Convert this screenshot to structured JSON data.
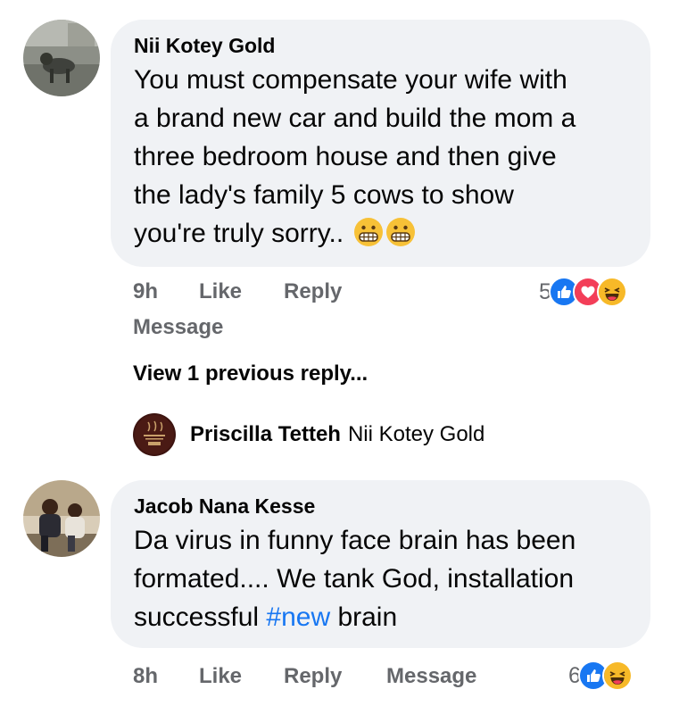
{
  "comments": [
    {
      "author": "Nii Kotey Gold",
      "text": "You must compensate your wife with a brand new car and build the mom a three bedroom house and then give the lady's family 5 cows to show you're truly sorry.. ",
      "lines": [
        "You must compensate your wife with",
        "a brand new car and build the mom a",
        "three bedroom house and then give",
        "the lady's family 5 cows to show",
        "you're truly sorry.. "
      ],
      "emoji": [
        "grimacing-emoji",
        "grimacing-emoji"
      ],
      "time": "9h",
      "like_label": "Like",
      "reply_label": "Reply",
      "message_label": "Message",
      "reaction_count": "5",
      "reactions": [
        "like-icon",
        "love-icon",
        "haha-icon"
      ]
    },
    {
      "author": "Jacob Nana Kesse",
      "lines": [
        "Da virus in funny face brain has been",
        "formated.... We tank God, installation"
      ],
      "last_line_before": "successful ",
      "hashtag": "#new",
      "last_line_after": " brain",
      "time": "8h",
      "like_label": "Like",
      "reply_label": "Reply",
      "message_label": "Message",
      "reaction_count": "6",
      "reactions": [
        "like-icon",
        "haha-icon"
      ]
    }
  ],
  "replies_section": {
    "view_previous": "View 1 previous reply...",
    "reply_author": "Priscilla Tetteh",
    "reply_mention": "Nii Kotey Gold"
  },
  "colors": {
    "bubble": "#f0f2f5",
    "secondary_text": "#65676b",
    "link_blue": "#1877f2",
    "like_blue": "#1877f2",
    "love_red": "#f33e58",
    "haha_yellow": "#f7b928"
  }
}
